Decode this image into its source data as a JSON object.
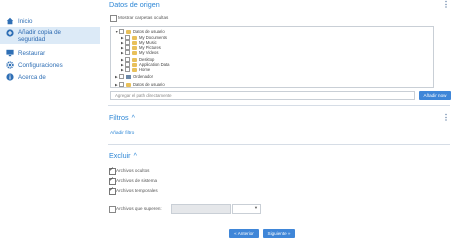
{
  "sidebar": {
    "items": [
      {
        "label": "Inicio",
        "icon": "home-icon",
        "active": false
      },
      {
        "label": "Añadir copia de seguridad",
        "icon": "add-backup-icon",
        "active": true
      },
      {
        "label": "Restaurar",
        "icon": "monitor-icon",
        "active": false
      },
      {
        "label": "Configuraciones",
        "icon": "gear-icon",
        "active": false
      },
      {
        "label": "Acerca de",
        "icon": "info-icon",
        "active": false
      }
    ]
  },
  "source": {
    "title": "Datos de origen",
    "show_hidden_label": "Mostrar carpetas ocultas",
    "tree": [
      {
        "label": "Datos de usuario",
        "depth": 0,
        "icon": "folder"
      },
      {
        "label": "My Documents",
        "depth": 1,
        "icon": "folder"
      },
      {
        "label": "My Music",
        "depth": 1,
        "icon": "folder"
      },
      {
        "label": "My Pictures",
        "depth": 1,
        "icon": "folder"
      },
      {
        "label": "My Videos",
        "depth": 1,
        "icon": "folder"
      },
      {
        "label": "Desktop",
        "depth": 1,
        "icon": "folder"
      },
      {
        "label": "Application Data",
        "depth": 1,
        "icon": "folder"
      },
      {
        "label": "Home",
        "depth": 1,
        "icon": "folder"
      },
      {
        "label": "Ordenador",
        "depth": 0,
        "icon": "pc"
      },
      {
        "label": "Datos de usuario",
        "depth": 0,
        "icon": "folder"
      }
    ],
    "path_placeholder": "Agregar el path directamente",
    "add_now_label": "Añadir now"
  },
  "filters": {
    "title": "Filtros",
    "add_filter_link": "Añadir filtro"
  },
  "exclude": {
    "title": "Excluir",
    "options": [
      {
        "label": "Archivos ocultos",
        "checked": true
      },
      {
        "label": "Archivos de sistema",
        "checked": true
      },
      {
        "label": "Archivos temporales",
        "checked": true
      }
    ],
    "larger_than_label": "Archivos que superen:",
    "larger_than_checked": false
  },
  "footer": {
    "prev_label": "« Anterior",
    "next_label": "Siguiente »"
  },
  "colors": {
    "accent": "#2e87d6",
    "button": "#3f86d8",
    "active_nav_bg": "#dceaf7"
  }
}
